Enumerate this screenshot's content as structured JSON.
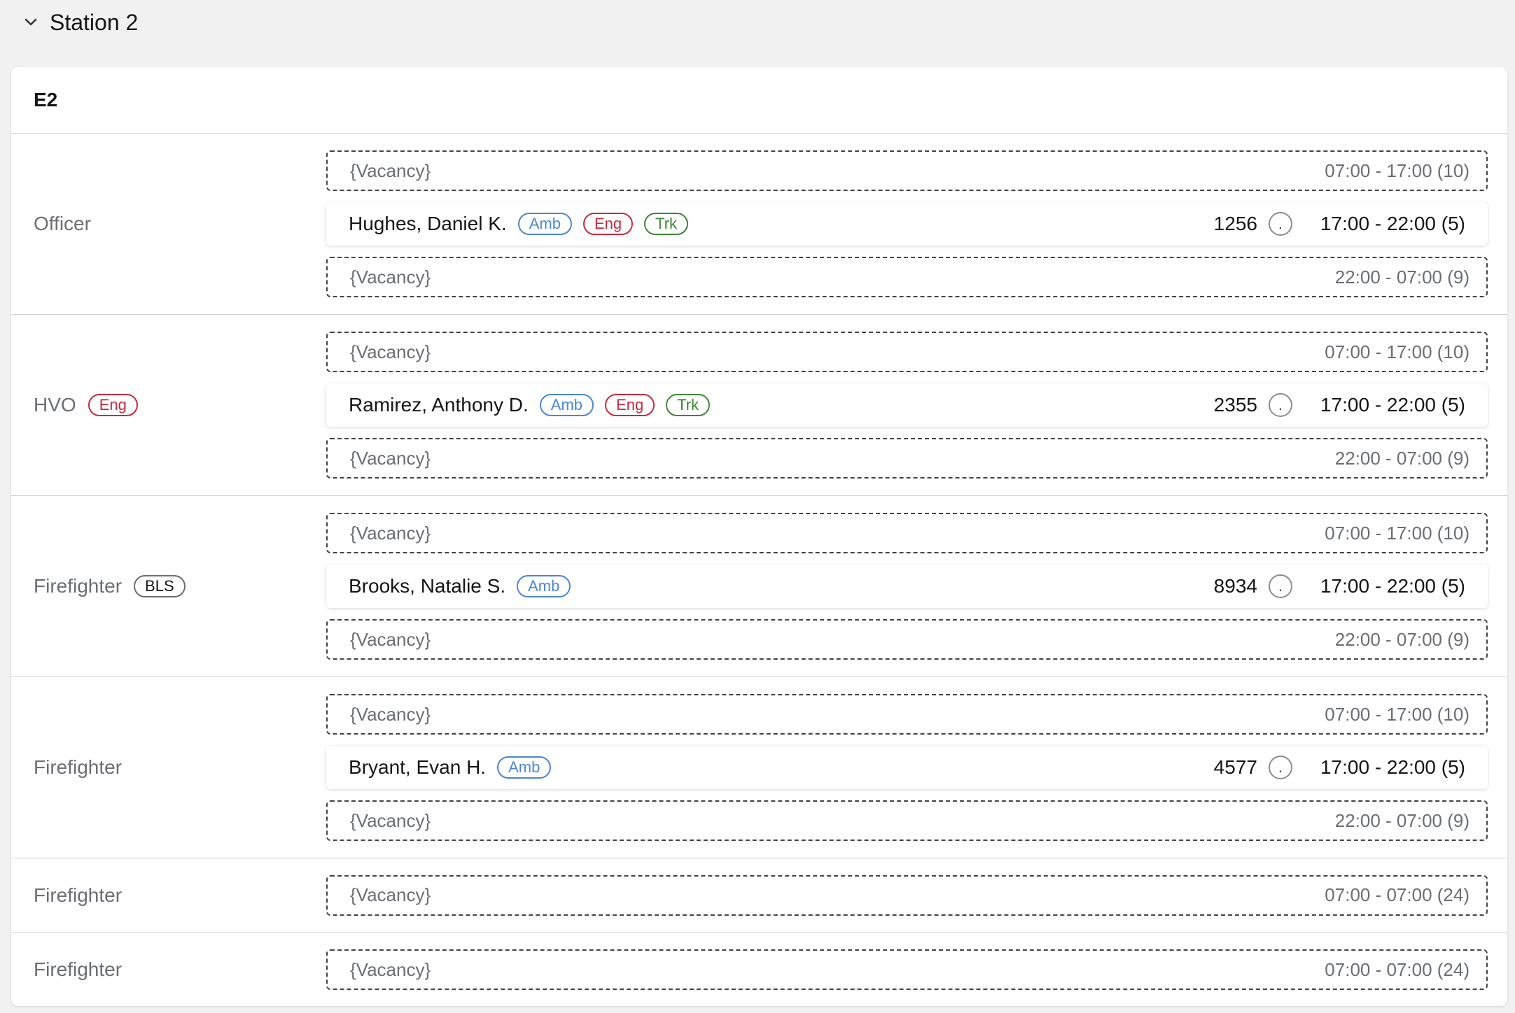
{
  "station": {
    "title": "Station 2"
  },
  "unit": {
    "title": "E2"
  },
  "rows": [
    {
      "role": "Officer",
      "shifts": [
        {
          "type": "vacancy",
          "label": "{Vacancy}",
          "time": "07:00 - 17:00 (10)"
        },
        {
          "type": "assigned",
          "name": "Hughes, Daniel K.",
          "badges": [
            "Amb",
            "Eng",
            "Trk"
          ],
          "number": "1256",
          "dot": ".",
          "time": "17:00 - 22:00 (5)"
        },
        {
          "type": "vacancy",
          "label": "{Vacancy}",
          "time": "22:00 - 07:00 (9)"
        }
      ]
    },
    {
      "role": "HVO",
      "role_badge": "Eng",
      "shifts": [
        {
          "type": "vacancy",
          "label": "{Vacancy}",
          "time": "07:00 - 17:00 (10)"
        },
        {
          "type": "assigned",
          "name": "Ramirez, Anthony D.",
          "badges": [
            "Amb",
            "Eng",
            "Trk"
          ],
          "number": "2355",
          "dot": ".",
          "time": "17:00 - 22:00 (5)"
        },
        {
          "type": "vacancy",
          "label": "{Vacancy}",
          "time": "22:00 - 07:00 (9)"
        }
      ]
    },
    {
      "role": "Firefighter",
      "role_badge": "BLS",
      "shifts": [
        {
          "type": "vacancy",
          "label": "{Vacancy}",
          "time": "07:00 - 17:00 (10)"
        },
        {
          "type": "assigned",
          "name": "Brooks, Natalie S.",
          "badges": [
            "Amb"
          ],
          "number": "8934",
          "dot": ".",
          "time": "17:00 - 22:00 (5)"
        },
        {
          "type": "vacancy",
          "label": "{Vacancy}",
          "time": "22:00 - 07:00 (9)"
        }
      ]
    },
    {
      "role": "Firefighter",
      "shifts": [
        {
          "type": "vacancy",
          "label": "{Vacancy}",
          "time": "07:00 - 17:00 (10)"
        },
        {
          "type": "assigned",
          "name": "Bryant, Evan H.",
          "badges": [
            "Amb"
          ],
          "number": "4577",
          "dot": ".",
          "time": "17:00 - 22:00 (5)"
        },
        {
          "type": "vacancy",
          "label": "{Vacancy}",
          "time": "22:00 - 07:00 (9)"
        }
      ]
    },
    {
      "role": "Firefighter",
      "shifts": [
        {
          "type": "vacancy",
          "label": "{Vacancy}",
          "time": "07:00 - 07:00 (24)"
        }
      ]
    },
    {
      "role": "Firefighter",
      "shifts": [
        {
          "type": "vacancy",
          "label": "{Vacancy}",
          "time": "07:00 - 07:00 (24)"
        }
      ]
    }
  ],
  "colors": {
    "amb": "#4a86d6",
    "eng": "#c9283e",
    "trk": "#3e8635"
  },
  "icons": {
    "collapse": "chevron-down-icon"
  }
}
